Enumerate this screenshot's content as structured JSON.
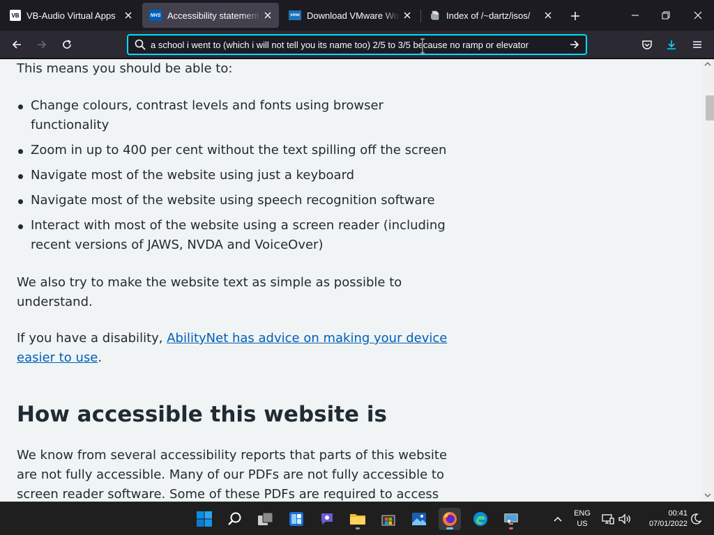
{
  "browser": {
    "tabs": [
      {
        "title": "VB-Audio Virtual Apps",
        "favicon": "vb-audio-icon",
        "active": false
      },
      {
        "title": "Accessibility statement - NHS",
        "favicon": "nhs-icon",
        "active": true
      },
      {
        "title": "Download VMware Workstation",
        "favicon": "vmware-icon",
        "active": false
      },
      {
        "title": "Index of /~dartz/isos/",
        "favicon": "folder-file-icon",
        "active": false
      }
    ],
    "favicon_text": {
      "vb": "VB",
      "nhs": "NHS",
      "vmware": "vmw"
    },
    "url_text": "a school i went to (which i will not tell you its name too) 2/5 to 3/5 because no ramp or elevator",
    "accent_color": "#00ddff"
  },
  "page": {
    "lead": "This means you should be able to:",
    "bullets": [
      "Change colours, contrast levels and fonts using browser functionality",
      "Zoom in up to 400 per cent without the text spilling off the screen",
      "Navigate most of the website using just a keyboard",
      "Navigate most of the website using speech recognition software",
      "Interact with most of the website using a screen reader (including recent versions of JAWS, NVDA and VoiceOver)"
    ],
    "simple_text": "We also try to make the website text as simple as possible to understand.",
    "disability_prefix": "If you have a disability, ",
    "disability_link": "AbilityNet has advice on making your device easier to use",
    "disability_suffix": ".",
    "heading": "How accessible this website is",
    "known_text": "We know from several accessibility reports that parts of this website are not fully accessible. Many of our PDFs are not fully accessible to screen reader software. Some of these PDFs are required to access a",
    "link_color": "#005eb8",
    "text_color": "#212b32",
    "background": "#f0f4f5"
  },
  "taskbar": {
    "apps": [
      "start-icon",
      "search-icon",
      "task-view-icon",
      "widgets-icon",
      "chat-icon",
      "file-explorer-icon",
      "store-icon",
      "photos-icon",
      "firefox-icon",
      "edge-icon",
      "remote-desktop-icon"
    ],
    "lang_line1": "ENG",
    "lang_line2": "US",
    "time": "00:41",
    "date": "07/01/2022"
  }
}
